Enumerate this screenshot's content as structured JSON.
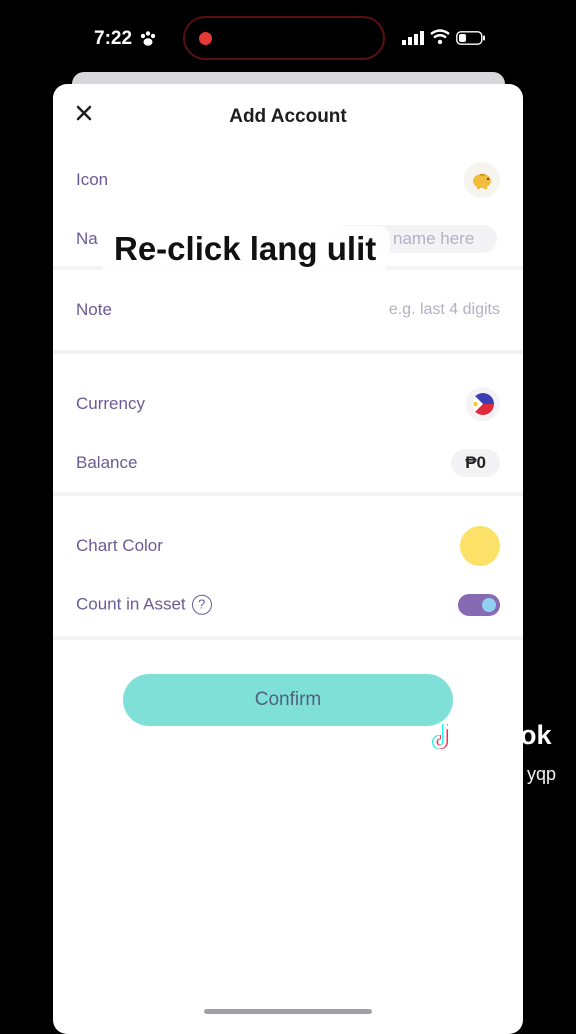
{
  "status_bar": {
    "time": "7:22"
  },
  "header": {
    "title": "Add Account"
  },
  "rows": {
    "icon_label": "Icon",
    "name_label": "Na",
    "name_placeholder": "name here",
    "note_label": "Note",
    "note_placeholder": "e.g. last 4 digits",
    "currency_label": "Currency",
    "balance_label": "Balance",
    "balance_value": "₱0",
    "chart_color_label": "Chart Color",
    "count_in_asset_label": "Count in Asset",
    "help_glyph": "?"
  },
  "confirm_label": "Confirm",
  "overlay_caption": "Re-click lang ulit",
  "watermark": {
    "brand": "ok",
    "handle": "yqp"
  },
  "colors": {
    "accent": "#8869b3",
    "confirm": "#7fe0d8",
    "chart_color": "#fce168",
    "label": "#6b5b95"
  },
  "toggle": {
    "count_in_asset": true
  },
  "icons": [
    "paw-icon",
    "signal-icon",
    "wifi-icon",
    "battery-icon",
    "close-icon",
    "piggy-bank-icon",
    "philippines-flag-icon",
    "help-icon",
    "tiktok-icon"
  ]
}
